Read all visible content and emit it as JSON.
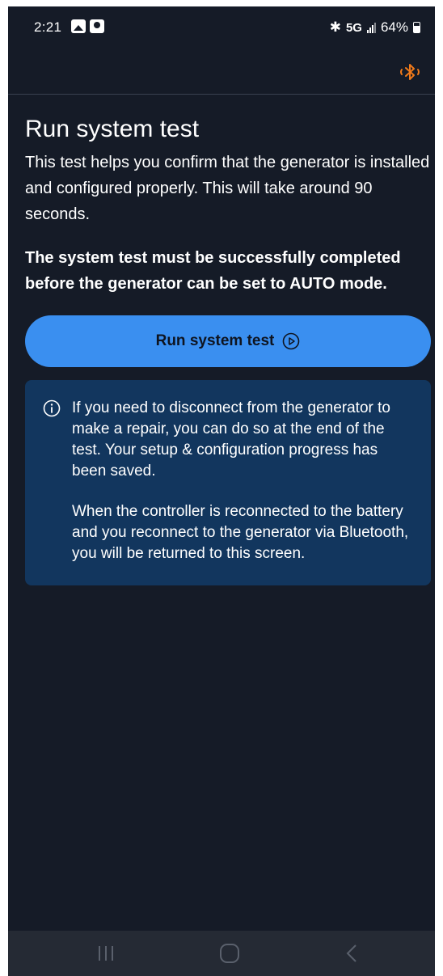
{
  "status_bar": {
    "time": "2:21",
    "network": "5G",
    "battery": "64%",
    "bluetooth_symbol": "✱"
  },
  "app_bar": {
    "icon": "bluetooth-connected-icon",
    "icon_color": "#f07a1a"
  },
  "main": {
    "title": "Run system test",
    "intro": "This test helps you confirm that the generator is installed and configured properly. This will take around 90 seconds.",
    "warning": "The system test must be successfully completed before the generator can be set to AUTO mode.",
    "run_button_label": "Run system test",
    "run_button_icon": "play-circle-icon",
    "info_card": {
      "icon": "info-icon",
      "paragraph_1": "If you need to disconnect from the generator to make a repair, you can do so at the end of the test. Your setup & configuration progress has been saved.",
      "paragraph_2": "When the controller is reconnected to the battery and you reconnect to the generator via Bluetooth, you will be returned to this screen."
    }
  },
  "nav_bar": {
    "icons": [
      "recent-apps-icon",
      "home-icon",
      "back-icon"
    ]
  },
  "colors": {
    "background": "#151b27",
    "accent_button": "#3a8ff0",
    "info_card": "#12365e",
    "bluetooth_icon": "#f07a1a"
  }
}
